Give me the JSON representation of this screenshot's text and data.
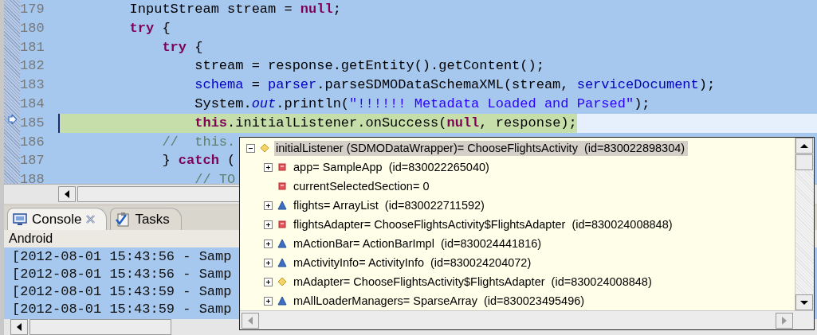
{
  "editor": {
    "lines": [
      {
        "number": "179",
        "current": false,
        "tokens": [
          {
            "kind": "plain",
            "text": "        InputStream stream = "
          },
          {
            "kind": "keyword",
            "text": "null"
          },
          {
            "kind": "plain",
            "text": ";"
          }
        ]
      },
      {
        "number": "180",
        "current": false,
        "tokens": [
          {
            "kind": "keyword",
            "text": "        try"
          },
          {
            "kind": "plain",
            "text": " {"
          }
        ]
      },
      {
        "number": "181",
        "current": false,
        "tokens": [
          {
            "kind": "keyword",
            "text": "            try"
          },
          {
            "kind": "plain",
            "text": " {"
          }
        ]
      },
      {
        "number": "182",
        "current": false,
        "tokens": [
          {
            "kind": "plain",
            "text": "                stream = response.getEntity().getContent();"
          }
        ]
      },
      {
        "number": "183",
        "current": false,
        "tokens": [
          {
            "kind": "field",
            "text": "                schema"
          },
          {
            "kind": "plain",
            "text": " = "
          },
          {
            "kind": "field",
            "text": "parser"
          },
          {
            "kind": "plain",
            "text": ".parseSDMODataSchemaXML(stream, "
          },
          {
            "kind": "field",
            "text": "serviceDocument"
          },
          {
            "kind": "plain",
            "text": ");"
          }
        ]
      },
      {
        "number": "184",
        "current": false,
        "tokens": [
          {
            "kind": "plain",
            "text": "                System."
          },
          {
            "kind": "static",
            "text": "out"
          },
          {
            "kind": "plain",
            "text": ".println("
          },
          {
            "kind": "string",
            "text": "\"!!!!!! Metadata Loaded and Parsed\""
          },
          {
            "kind": "plain",
            "text": ");"
          }
        ]
      },
      {
        "number": "185",
        "current": true,
        "tokens": [
          {
            "kind": "keyword",
            "text": "                this"
          },
          {
            "kind": "plain",
            "text": ".initialListener.onSuccess("
          },
          {
            "kind": "keyword",
            "text": "null"
          },
          {
            "kind": "plain",
            "text": ", response);"
          }
        ]
      },
      {
        "number": "186",
        "current": false,
        "tokens": [
          {
            "kind": "comment",
            "text": "            //  this."
          }
        ]
      },
      {
        "number": "187",
        "current": false,
        "tokens": [
          {
            "kind": "plain",
            "text": "            } "
          },
          {
            "kind": "keyword",
            "text": "catch"
          },
          {
            "kind": "plain",
            "text": " ("
          }
        ]
      },
      {
        "number": "188",
        "current": false,
        "tokens": [
          {
            "kind": "comment",
            "text": "                // TO"
          }
        ]
      }
    ]
  },
  "console": {
    "tabs": [
      {
        "label": "Console",
        "selected": true,
        "closable": true
      },
      {
        "label": "Tasks",
        "selected": false,
        "closable": false
      }
    ],
    "title": "Android",
    "lines": [
      "[2012-08-01 15:43:56 - Samp",
      "[2012-08-01 15:43:56 - Samp",
      "[2012-08-01 15:43:59 - Samp",
      "[2012-08-01 15:43:59 - Samp"
    ]
  },
  "variable_popup": {
    "root": {
      "label": "initialListener (SDMODataWrapper)= ChooseFlightsActivity  (id=830022898304)",
      "kind": "protected",
      "expanded": true,
      "selected": true,
      "children": [
        {
          "label": "app= SampleApp  (id=830022265040)",
          "kind": "private",
          "has_children": true
        },
        {
          "label": "currentSelectedSection= 0",
          "kind": "private",
          "has_children": false
        },
        {
          "label": "flights= ArrayList  (id=830022711592)",
          "kind": "package",
          "has_children": true
        },
        {
          "label": "flightsAdapter= ChooseFlightsActivity$FlightsAdapter  (id=830024008848)",
          "kind": "private",
          "has_children": true
        },
        {
          "label": "mActionBar= ActionBarImpl  (id=830024441816)",
          "kind": "package",
          "has_children": true
        },
        {
          "label": "mActivityInfo= ActivityInfo  (id=830024204072)",
          "kind": "package",
          "has_children": true
        },
        {
          "label": "mAdapter= ChooseFlightsActivity$FlightsAdapter  (id=830024008848)",
          "kind": "protected",
          "has_children": true
        },
        {
          "label": "mAllLoaderManagers= SparseArray  (id=830023495496)",
          "kind": "package",
          "has_children": true
        }
      ]
    }
  }
}
